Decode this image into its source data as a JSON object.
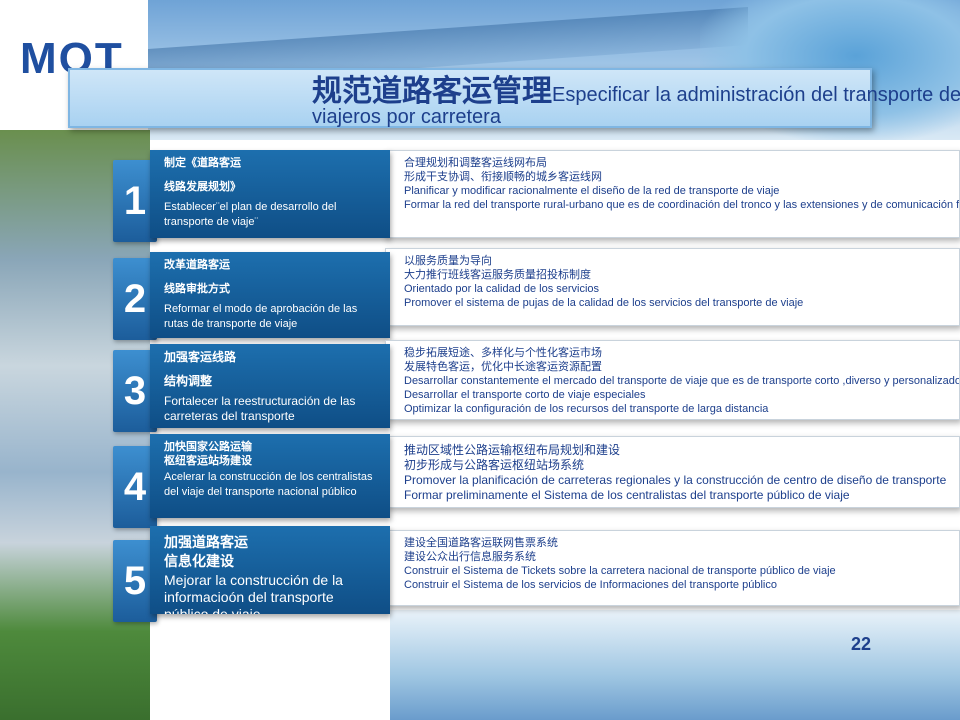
{
  "logo": "MOT",
  "title": {
    "zh": "规范道路客运管理",
    "es_line1": "Especificar la administración del transporte de",
    "es_line2": "viajeros por carretera"
  },
  "items": [
    {
      "number": "1",
      "box": [
        "制定《道路客运",
        "线路发展规划》",
        "Establecer¨el plan de desarrollo del transporte de viaje¨"
      ],
      "lines": [
        "合理规划和调整客运线网布局",
        "形成干支协调、衔接顺畅的城乡客运线网",
        "Planificar y modificar racionalmente el diseño de la red de transporte de viaje",
        "Formar la red del transporte rural-urbano que es de coordinación del tronco y las extensiones y de comunicación fluida"
      ]
    },
    {
      "number": "2",
      "box": [
        "改革道路客运",
        "线路审批方式",
        "Reformar el modo de aprobación de las rutas de transporte de viaje"
      ],
      "lines": [
        "以服务质量为导向",
        "大力推行班线客运服务质量招投标制度",
        "Orientado por la calidad de los servicios",
        "Promover el sistema de pujas de la calidad de los servicios del transporte de viaje"
      ]
    },
    {
      "number": "3",
      "box": [
        "加强客运线路",
        "结构调整",
        "Fortalecer la reestructuración de las carreteras del transporte"
      ],
      "lines": [
        "稳步拓展短途、多样化与个性化客运市场",
        "发展特色客运，优化中长途客运资源配置",
        "Desarrollar constantemente el mercado del transporte de viaje que es de transporte corto ,diverso y personalizado",
        "Desarrollar el transporte corto de viaje especiales",
        "Optimizar la configuración de los recursos del transporte de larga distancia"
      ]
    },
    {
      "number": "4",
      "box": [
        "加快国家公路运输",
        "枢纽客运站场建设",
        "Acelerar la construcción de los centralistas del viaje del transporte nacional público"
      ],
      "lines": [
        "推动区域性公路运输枢纽布局规划和建设",
        "初步形成与公路客运枢纽站场系统",
        "Promover la planificación de carreteras regionales y la construcción de centro de diseño de transporte",
        "Formar preliminamente el Sistema de los centralistas del transporte público de viaje"
      ]
    },
    {
      "number": "5",
      "box": [
        "加强道路客运",
        "信息化建设",
        "Mejorar la construcción de la informacioón del transporte público de viaje"
      ],
      "lines": [
        "建设全国道路客运联网售票系统",
        "建设公众出行信息服务系统",
        "Construir el Sistema de Tickets sobre la carretera nacional de transporte público de viaje",
        "Construir el Sistema de los servicios de Informaciones del transporte público"
      ]
    }
  ],
  "page_number": "22"
}
